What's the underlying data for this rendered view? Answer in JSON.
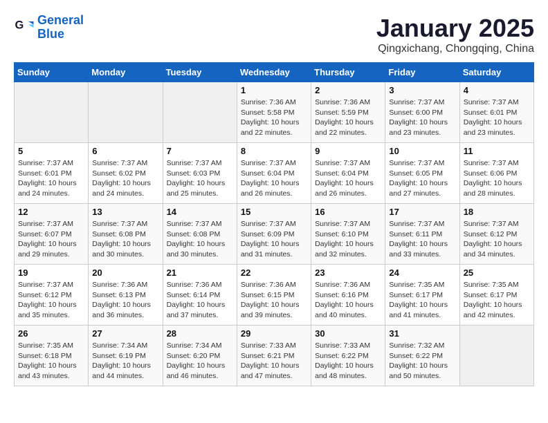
{
  "header": {
    "logo_line1": "General",
    "logo_line2": "Blue",
    "title": "January 2025",
    "subtitle": "Qingxichang, Chongqing, China"
  },
  "weekdays": [
    "Sunday",
    "Monday",
    "Tuesday",
    "Wednesday",
    "Thursday",
    "Friday",
    "Saturday"
  ],
  "weeks": [
    [
      {
        "day": "",
        "info": ""
      },
      {
        "day": "",
        "info": ""
      },
      {
        "day": "",
        "info": ""
      },
      {
        "day": "1",
        "info": "Sunrise: 7:36 AM\nSunset: 5:58 PM\nDaylight: 10 hours\nand 22 minutes."
      },
      {
        "day": "2",
        "info": "Sunrise: 7:36 AM\nSunset: 5:59 PM\nDaylight: 10 hours\nand 22 minutes."
      },
      {
        "day": "3",
        "info": "Sunrise: 7:37 AM\nSunset: 6:00 PM\nDaylight: 10 hours\nand 23 minutes."
      },
      {
        "day": "4",
        "info": "Sunrise: 7:37 AM\nSunset: 6:01 PM\nDaylight: 10 hours\nand 23 minutes."
      }
    ],
    [
      {
        "day": "5",
        "info": "Sunrise: 7:37 AM\nSunset: 6:01 PM\nDaylight: 10 hours\nand 24 minutes."
      },
      {
        "day": "6",
        "info": "Sunrise: 7:37 AM\nSunset: 6:02 PM\nDaylight: 10 hours\nand 24 minutes."
      },
      {
        "day": "7",
        "info": "Sunrise: 7:37 AM\nSunset: 6:03 PM\nDaylight: 10 hours\nand 25 minutes."
      },
      {
        "day": "8",
        "info": "Sunrise: 7:37 AM\nSunset: 6:04 PM\nDaylight: 10 hours\nand 26 minutes."
      },
      {
        "day": "9",
        "info": "Sunrise: 7:37 AM\nSunset: 6:04 PM\nDaylight: 10 hours\nand 26 minutes."
      },
      {
        "day": "10",
        "info": "Sunrise: 7:37 AM\nSunset: 6:05 PM\nDaylight: 10 hours\nand 27 minutes."
      },
      {
        "day": "11",
        "info": "Sunrise: 7:37 AM\nSunset: 6:06 PM\nDaylight: 10 hours\nand 28 minutes."
      }
    ],
    [
      {
        "day": "12",
        "info": "Sunrise: 7:37 AM\nSunset: 6:07 PM\nDaylight: 10 hours\nand 29 minutes."
      },
      {
        "day": "13",
        "info": "Sunrise: 7:37 AM\nSunset: 6:08 PM\nDaylight: 10 hours\nand 30 minutes."
      },
      {
        "day": "14",
        "info": "Sunrise: 7:37 AM\nSunset: 6:08 PM\nDaylight: 10 hours\nand 30 minutes."
      },
      {
        "day": "15",
        "info": "Sunrise: 7:37 AM\nSunset: 6:09 PM\nDaylight: 10 hours\nand 31 minutes."
      },
      {
        "day": "16",
        "info": "Sunrise: 7:37 AM\nSunset: 6:10 PM\nDaylight: 10 hours\nand 32 minutes."
      },
      {
        "day": "17",
        "info": "Sunrise: 7:37 AM\nSunset: 6:11 PM\nDaylight: 10 hours\nand 33 minutes."
      },
      {
        "day": "18",
        "info": "Sunrise: 7:37 AM\nSunset: 6:12 PM\nDaylight: 10 hours\nand 34 minutes."
      }
    ],
    [
      {
        "day": "19",
        "info": "Sunrise: 7:37 AM\nSunset: 6:12 PM\nDaylight: 10 hours\nand 35 minutes."
      },
      {
        "day": "20",
        "info": "Sunrise: 7:36 AM\nSunset: 6:13 PM\nDaylight: 10 hours\nand 36 minutes."
      },
      {
        "day": "21",
        "info": "Sunrise: 7:36 AM\nSunset: 6:14 PM\nDaylight: 10 hours\nand 37 minutes."
      },
      {
        "day": "22",
        "info": "Sunrise: 7:36 AM\nSunset: 6:15 PM\nDaylight: 10 hours\nand 39 minutes."
      },
      {
        "day": "23",
        "info": "Sunrise: 7:36 AM\nSunset: 6:16 PM\nDaylight: 10 hours\nand 40 minutes."
      },
      {
        "day": "24",
        "info": "Sunrise: 7:35 AM\nSunset: 6:17 PM\nDaylight: 10 hours\nand 41 minutes."
      },
      {
        "day": "25",
        "info": "Sunrise: 7:35 AM\nSunset: 6:17 PM\nDaylight: 10 hours\nand 42 minutes."
      }
    ],
    [
      {
        "day": "26",
        "info": "Sunrise: 7:35 AM\nSunset: 6:18 PM\nDaylight: 10 hours\nand 43 minutes."
      },
      {
        "day": "27",
        "info": "Sunrise: 7:34 AM\nSunset: 6:19 PM\nDaylight: 10 hours\nand 44 minutes."
      },
      {
        "day": "28",
        "info": "Sunrise: 7:34 AM\nSunset: 6:20 PM\nDaylight: 10 hours\nand 46 minutes."
      },
      {
        "day": "29",
        "info": "Sunrise: 7:33 AM\nSunset: 6:21 PM\nDaylight: 10 hours\nand 47 minutes."
      },
      {
        "day": "30",
        "info": "Sunrise: 7:33 AM\nSunset: 6:22 PM\nDaylight: 10 hours\nand 48 minutes."
      },
      {
        "day": "31",
        "info": "Sunrise: 7:32 AM\nSunset: 6:22 PM\nDaylight: 10 hours\nand 50 minutes."
      },
      {
        "day": "",
        "info": ""
      }
    ]
  ]
}
